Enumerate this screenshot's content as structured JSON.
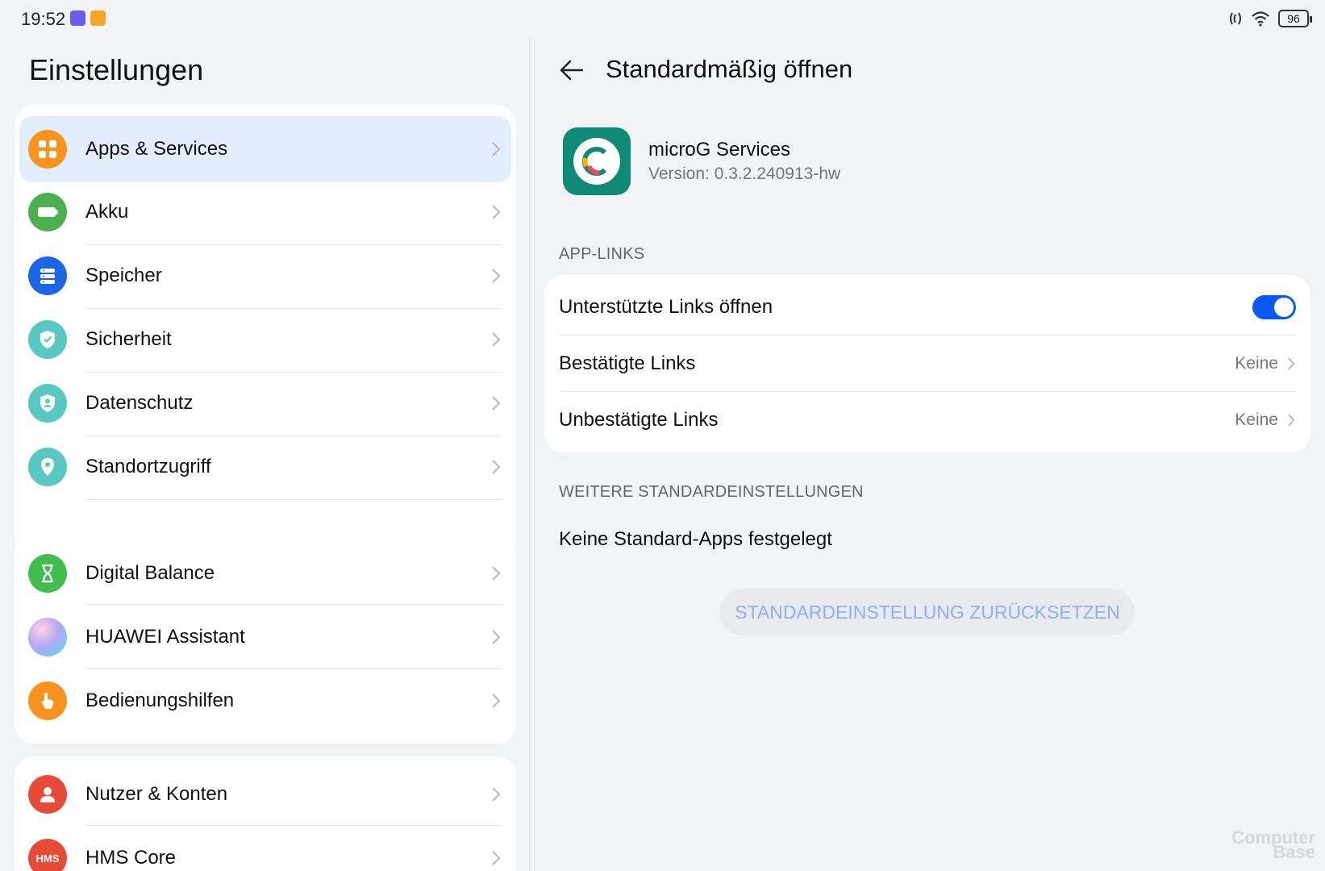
{
  "status_bar": {
    "time": "19:52",
    "battery": "96"
  },
  "left": {
    "title": "Einstellungen",
    "group1": [
      {
        "label": "Apps & Services",
        "icon": "apps-icon",
        "color": "#f7931e"
      },
      {
        "label": "Akku",
        "icon": "battery-icon",
        "color": "#4cb050"
      },
      {
        "label": "Speicher",
        "icon": "storage-icon",
        "color": "#1a66e6"
      },
      {
        "label": "Sicherheit",
        "icon": "shield-icon",
        "color": "#5ac8c2"
      },
      {
        "label": "Datenschutz",
        "icon": "privacy-icon",
        "color": "#5ac8c2"
      },
      {
        "label": "Standortzugriff",
        "icon": "location-icon",
        "color": "#5ac8c2"
      }
    ],
    "group2": [
      {
        "label": "Digital Balance",
        "icon": "hourglass-icon",
        "color": "#3fbe4f"
      },
      {
        "label": "HUAWEI Assistant",
        "icon": "assistant-icon",
        "color": "#b8a8f5"
      },
      {
        "label": "Bedienungshilfen",
        "icon": "hand-icon",
        "color": "#f7931e"
      }
    ],
    "group3": [
      {
        "label": "Nutzer & Konten",
        "icon": "user-icon",
        "color": "#e84a3a"
      },
      {
        "label": "HMS Core",
        "icon": "hms-icon",
        "color": "#e84a3a",
        "badge": "HMS"
      }
    ]
  },
  "right": {
    "title": "Standardmäßig öffnen",
    "app": {
      "name": "microG Services",
      "version": "Version: 0.3.2.240913-hw"
    },
    "app_links_header": "APP-LINKS",
    "links": {
      "open_supported": "Unterstützte Links öffnen",
      "open_supported_on": true,
      "verified": "Bestätigte Links",
      "verified_value": "Keine",
      "unverified": "Unbestätigte Links",
      "unverified_value": "Keine"
    },
    "more_header": "WEITERE STANDARDEINSTELLUNGEN",
    "no_defaults": "Keine Standard-Apps festgelegt",
    "reset_button": "STANDARDEINSTELLUNG ZURÜCKSETZEN"
  },
  "watermark": {
    "line1": "Computer",
    "line2": "Base"
  }
}
